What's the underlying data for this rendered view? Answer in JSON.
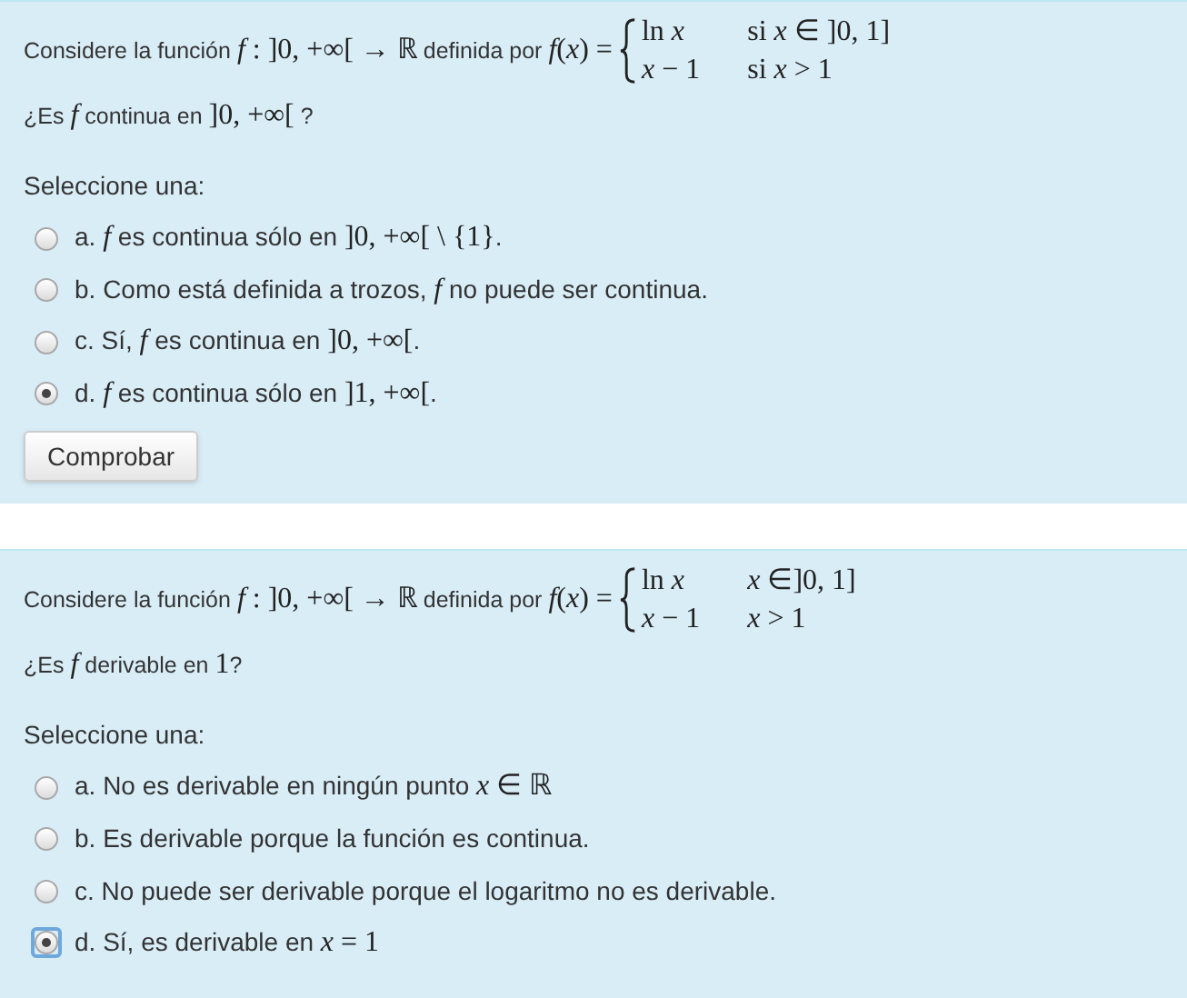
{
  "questions": [
    {
      "intro": [
        {
          "kind": "text",
          "text": "Considere la función "
        },
        {
          "kind": "math",
          "text": "*f* : ]0, +∞[ → ℝ"
        },
        {
          "kind": "text",
          "text": " definida por "
        },
        {
          "kind": "math",
          "text": "*f*(*x*) ="
        }
      ],
      "cases": [
        {
          "expr": "ln *x*",
          "cond": "si *x* ∈ ]0, 1]"
        },
        {
          "expr": "*x* − 1",
          "cond": "si *x* > 1"
        }
      ],
      "question": [
        {
          "kind": "text",
          "text": "¿Es "
        },
        {
          "kind": "math",
          "text": "*f*"
        },
        {
          "kind": "text",
          "text": " continua en "
        },
        {
          "kind": "math",
          "text": "]0, +∞["
        },
        {
          "kind": "text",
          "text": " ?"
        }
      ],
      "select_label": "Seleccione una:",
      "options": [
        {
          "selected": false,
          "focused": false,
          "label": [
            {
              "kind": "text",
              "text": "a. "
            },
            {
              "kind": "math",
              "text": "*f*"
            },
            {
              "kind": "text",
              "text": " es continua sólo en "
            },
            {
              "kind": "math",
              "text": "]0, +∞[ \\ {1}"
            },
            {
              "kind": "text",
              "text": "."
            }
          ]
        },
        {
          "selected": false,
          "focused": false,
          "label": [
            {
              "kind": "text",
              "text": "b. Como está definida a trozos, "
            },
            {
              "kind": "math",
              "text": "*f*"
            },
            {
              "kind": "text",
              "text": " no puede ser continua."
            }
          ]
        },
        {
          "selected": false,
          "focused": false,
          "label": [
            {
              "kind": "text",
              "text": "c. Sí, "
            },
            {
              "kind": "math",
              "text": "*f*"
            },
            {
              "kind": "text",
              "text": " es continua en "
            },
            {
              "kind": "math",
              "text": "]0, +∞["
            },
            {
              "kind": "text",
              "text": "."
            }
          ]
        },
        {
          "selected": true,
          "focused": false,
          "label": [
            {
              "kind": "text",
              "text": "d. "
            },
            {
              "kind": "math",
              "text": "*f*"
            },
            {
              "kind": "text",
              "text": " es continua sólo en "
            },
            {
              "kind": "math",
              "text": "]1, +∞["
            },
            {
              "kind": "text",
              "text": "."
            }
          ]
        }
      ],
      "button": "Comprobar"
    },
    {
      "intro": [
        {
          "kind": "text",
          "text": "Considere la función "
        },
        {
          "kind": "math",
          "text": "*f* : ]0, +∞[ → ℝ"
        },
        {
          "kind": "text",
          "text": " definida por "
        },
        {
          "kind": "math",
          "text": "*f*(*x*) ="
        }
      ],
      "cases": [
        {
          "expr": "ln *x*",
          "cond": "*x* ∈]0, 1]"
        },
        {
          "expr": "*x* − 1",
          "cond": "*x* > 1"
        }
      ],
      "question": [
        {
          "kind": "text",
          "text": "¿Es "
        },
        {
          "kind": "math",
          "text": "*f*"
        },
        {
          "kind": "text",
          "text": " derivable en "
        },
        {
          "kind": "math",
          "text": "1"
        },
        {
          "kind": "text",
          "text": "?"
        }
      ],
      "select_label": "Seleccione una:",
      "options": [
        {
          "selected": false,
          "focused": false,
          "label": [
            {
              "kind": "text",
              "text": "a. No es derivable en ningún punto "
            },
            {
              "kind": "math",
              "text": "*x* ∈ ℝ"
            }
          ]
        },
        {
          "selected": false,
          "focused": false,
          "label": [
            {
              "kind": "text",
              "text": "b. Es derivable porque la función es continua."
            }
          ]
        },
        {
          "selected": false,
          "focused": false,
          "label": [
            {
              "kind": "text",
              "text": "c. No puede ser derivable porque el logaritmo no es derivable."
            }
          ]
        },
        {
          "selected": true,
          "focused": true,
          "label": [
            {
              "kind": "text",
              "text": "d. Sí, es derivable en "
            },
            {
              "kind": "math",
              "text": "*x* = 1"
            }
          ]
        }
      ]
    }
  ]
}
